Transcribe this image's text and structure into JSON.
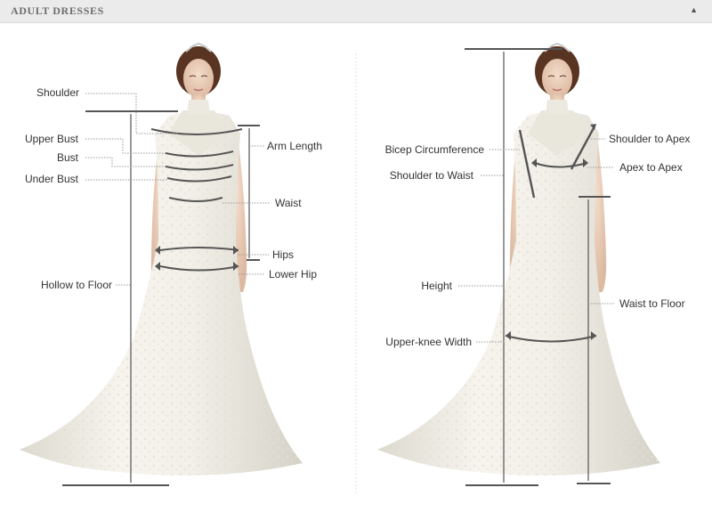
{
  "header": {
    "title": "ADULT DRESSES",
    "collapse_icon": "triangle-up-icon"
  },
  "left_labels": {
    "shoulder": "Shoulder",
    "upper_bust": "Upper Bust",
    "bust": "Bust",
    "under_bust": "Under Bust",
    "hollow_to_floor": "Hollow to Floor",
    "arm_length": "Arm Length",
    "waist": "Waist",
    "hips": "Hips",
    "lower_hip": "Lower Hip"
  },
  "right_labels": {
    "bicep_circumference": "Bicep Circumference",
    "shoulder_to_waist": "Shoulder to Waist",
    "height": "Height",
    "upper_knee_width": "Upper-knee Width",
    "shoulder_to_apex": "Shoulder to Apex",
    "apex_to_apex": "Apex to Apex",
    "waist_to_floor": "Waist to Floor"
  }
}
